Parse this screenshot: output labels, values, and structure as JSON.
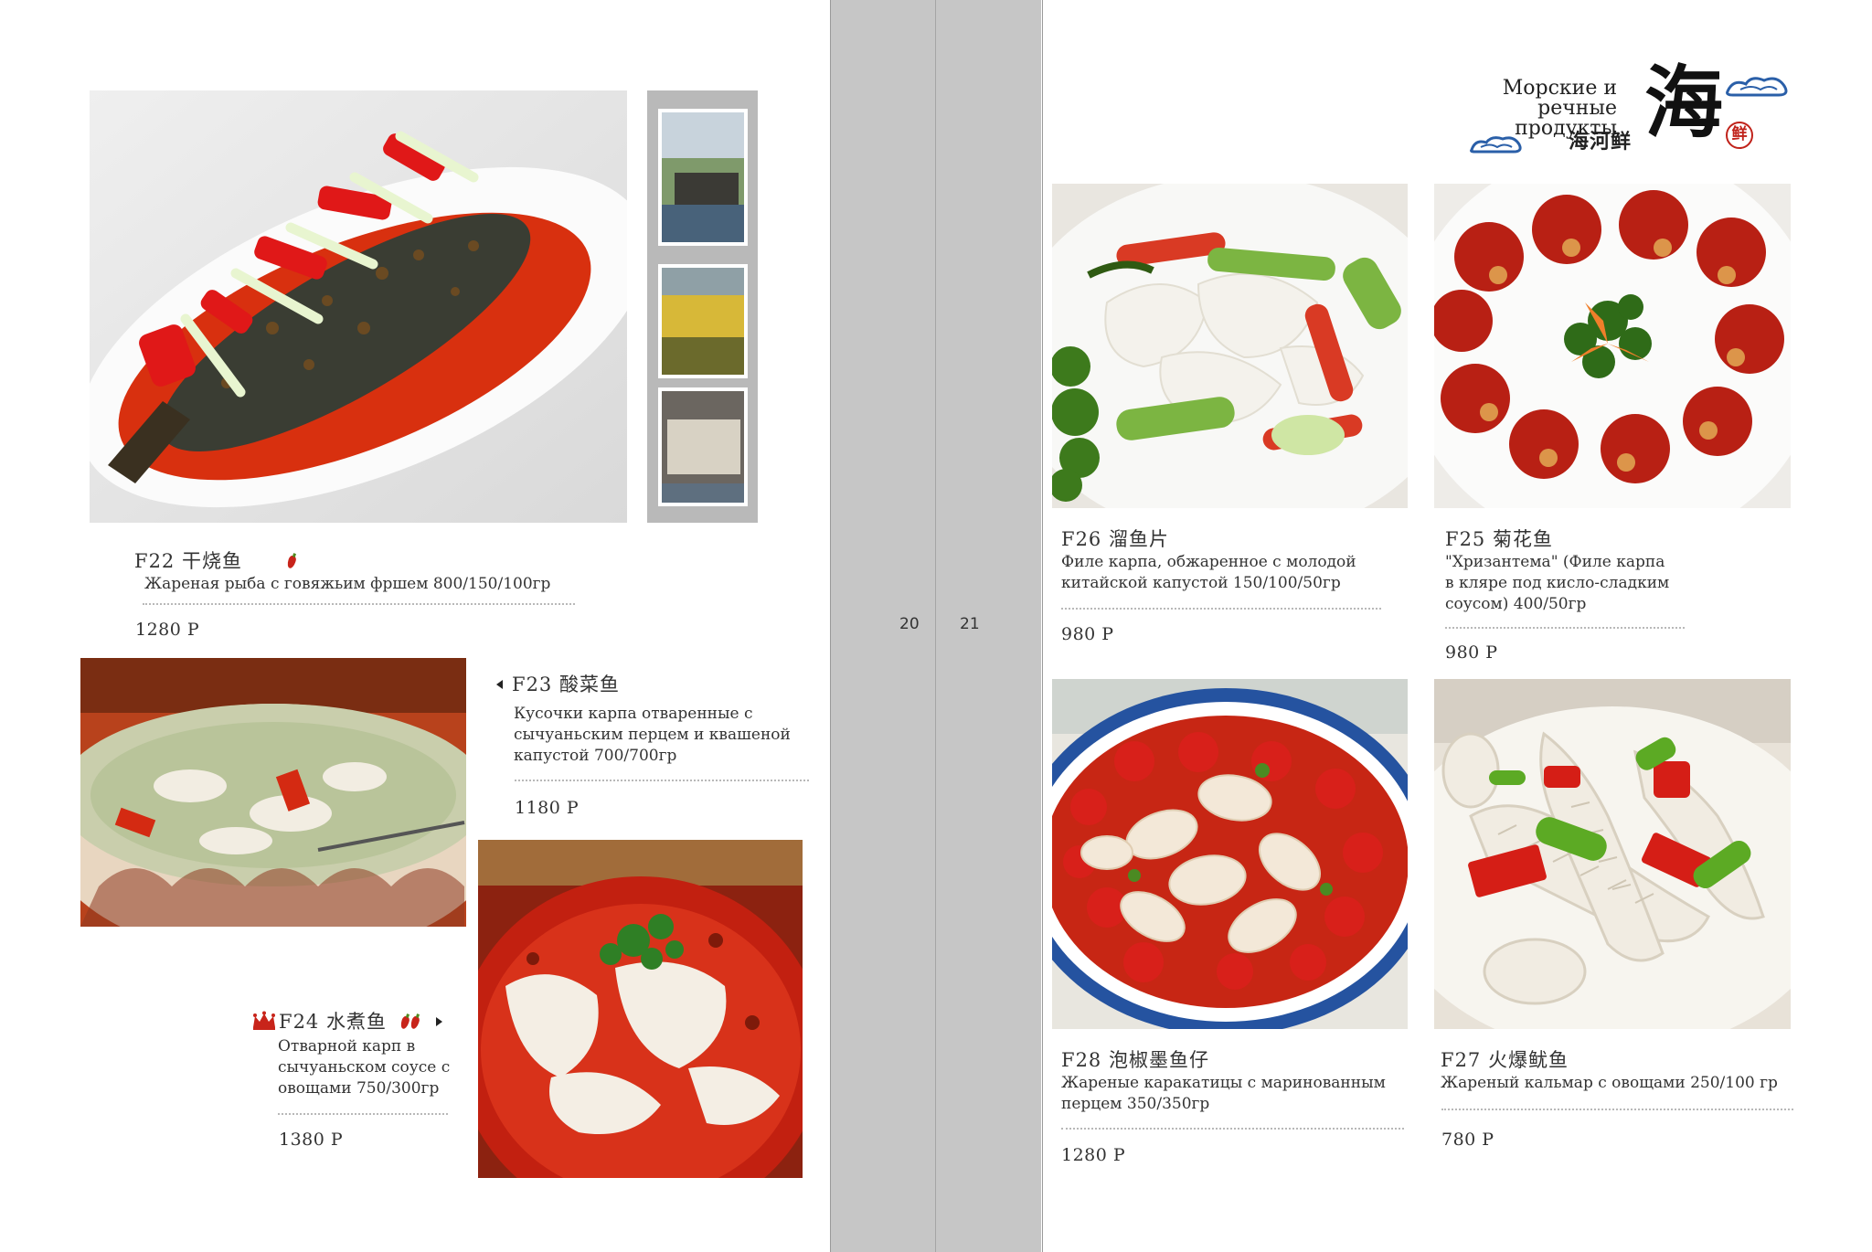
{
  "page_numbers": {
    "left": "20",
    "right": "21"
  },
  "header": {
    "title_ru_line1": "Морские и речные",
    "title_ru_line2": "продукты",
    "title_zh": "海河鲜",
    "big_char": "海",
    "seal_char": "鲜"
  },
  "left_page": {
    "f22": {
      "code": "F22 干烧鱼",
      "description": "Жареная рыба с говяжьим фршем  800/150/100гр",
      "price": "1280 Р",
      "icons": [
        "pepper-icon"
      ]
    },
    "f23": {
      "code": "F23  酸菜鱼",
      "description_line1": "Кусочки карпа отваренные  с",
      "description_line2": "сычуаньским  перцем и квашеной",
      "description_line3": "капустой  700/700гр",
      "price": "1180  Р",
      "icons": [
        "arrow-left-icon"
      ]
    },
    "f24": {
      "code": "F24  水煮鱼",
      "description_line1": "Отварной карп в",
      "description_line2": "сычуаньском соусе с",
      "description_line3": "овощами  750/300гр",
      "price": "1380  Р",
      "icons": [
        "crown-icon",
        "pepper-icon",
        "pepper-icon",
        "arrow-right-icon"
      ]
    }
  },
  "right_page": {
    "f26": {
      "code": "F26  溜鱼片",
      "description_line1": "Филе карпа, обжаренное с  молодой",
      "description_line2": "китайской капустой  150/100/50гр",
      "price": "980  Р"
    },
    "f25": {
      "code": "F25 菊花鱼",
      "description_line1": "\"Хризантема\" (Филе карпа",
      "description_line2": "в кляре под кисло-сладким",
      "description_line3": "соусом) 400/50гр",
      "price": "980  Р"
    },
    "f28": {
      "code": "F28  泡椒墨鱼仔",
      "description_line1": "Жареные каракатицы с маринованным",
      "description_line2": "перцем  350/350гр",
      "price": "1280  Р"
    },
    "f27": {
      "code": "F27 火爆鱿鱼",
      "description": "Жареный кальмар с овощами   250/100 гр",
      "price": "780  Р"
    }
  },
  "colors": {
    "gutter": "#c6c6c6",
    "pepper_red": "#c8241a",
    "seal_red": "#c0221a",
    "cloud_blue": "#2a5fa8"
  }
}
